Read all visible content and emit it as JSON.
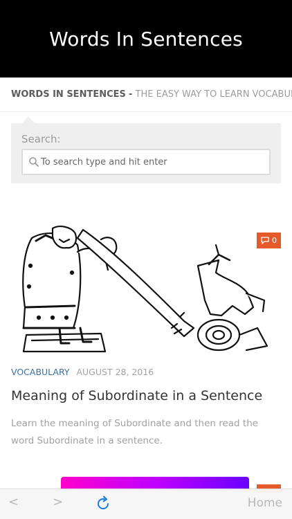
{
  "header": {
    "site_title": "Words In Sentences"
  },
  "tagline": {
    "site_name": "WORDS IN SENTENCES",
    "separator": "-",
    "description": "THE EASY WAY TO LEARN VOCABULARY"
  },
  "search": {
    "label": "Search:",
    "placeholder": "To search type and hit enter",
    "value": ""
  },
  "post": {
    "comment_count": "0",
    "category": "VOCABULARY",
    "date": "AUGUST 28, 2016",
    "title": "Meaning of Subordinate in a Sentence",
    "excerpt": "Learn the meaning of Subordinate and then read the word Subordinate in a sentence."
  },
  "toolbar": {
    "back_label": "<",
    "forward_label": ">",
    "home_label": "Home"
  },
  "colors": {
    "header_bg": "#000000",
    "accent_badge": "#e45a2a",
    "category_link": "#3b6ea5",
    "refresh_icon": "#1a7ad9"
  },
  "icons": {
    "search": "search-icon",
    "comment": "comment-bubble-icon",
    "refresh": "refresh-icon"
  }
}
